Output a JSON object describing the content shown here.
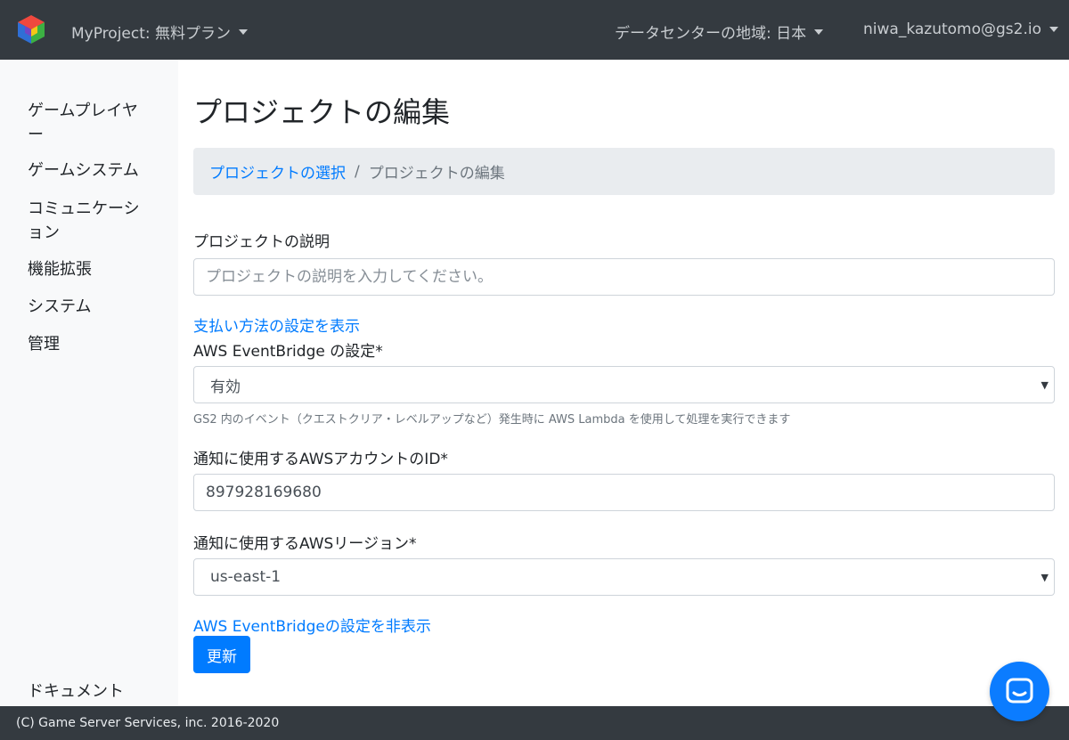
{
  "header": {
    "project": "MyProject: 無料プラン",
    "region": "データセンターの地域: 日本",
    "user": "niwa_kazutomo@gs2.io"
  },
  "sidebar": {
    "items": [
      {
        "label": "ゲームプレイヤー"
      },
      {
        "label": "ゲームシステム"
      },
      {
        "label": "コミュニケーション"
      },
      {
        "label": "機能拡張"
      },
      {
        "label": "システム"
      },
      {
        "label": "管理"
      }
    ],
    "docs": "ドキュメント"
  },
  "main": {
    "title": "プロジェクトの編集",
    "breadcrumb": {
      "link": "プロジェクトの選択",
      "separator": "/",
      "current": "プロジェクトの編集"
    },
    "description": {
      "label": "プロジェクトの説明",
      "placeholder": "プロジェクトの説明を入力してください。",
      "value": ""
    },
    "payment_link": "支払い方法の設定を表示",
    "eventbridge": {
      "label": "AWS EventBridge の設定*",
      "selected": "有効",
      "help": "GS2 内のイベント（クエストクリア・レベルアップなど）発生時に AWS Lambda を使用して処理を実行できます"
    },
    "account_id": {
      "label": "通知に使用するAWSアカウントのID*",
      "value": "897928169680"
    },
    "aws_region": {
      "label": "通知に使用するAWSリージョン*",
      "selected": "us-east-1"
    },
    "hide_link": "AWS EventBridgeの設定を非表示",
    "submit": "更新"
  },
  "footer": {
    "copyright": "(C) Game Server Services, inc. 2016-2020"
  },
  "colors": {
    "topbar": "#343a40",
    "primary": "#007bff",
    "sidebar": "#f8f9fa",
    "breadcrumb": "#e9ecef",
    "chat": "#0b7cff"
  },
  "icons": {
    "logo": "cube-logo-icon",
    "chat": "chat-icon"
  }
}
